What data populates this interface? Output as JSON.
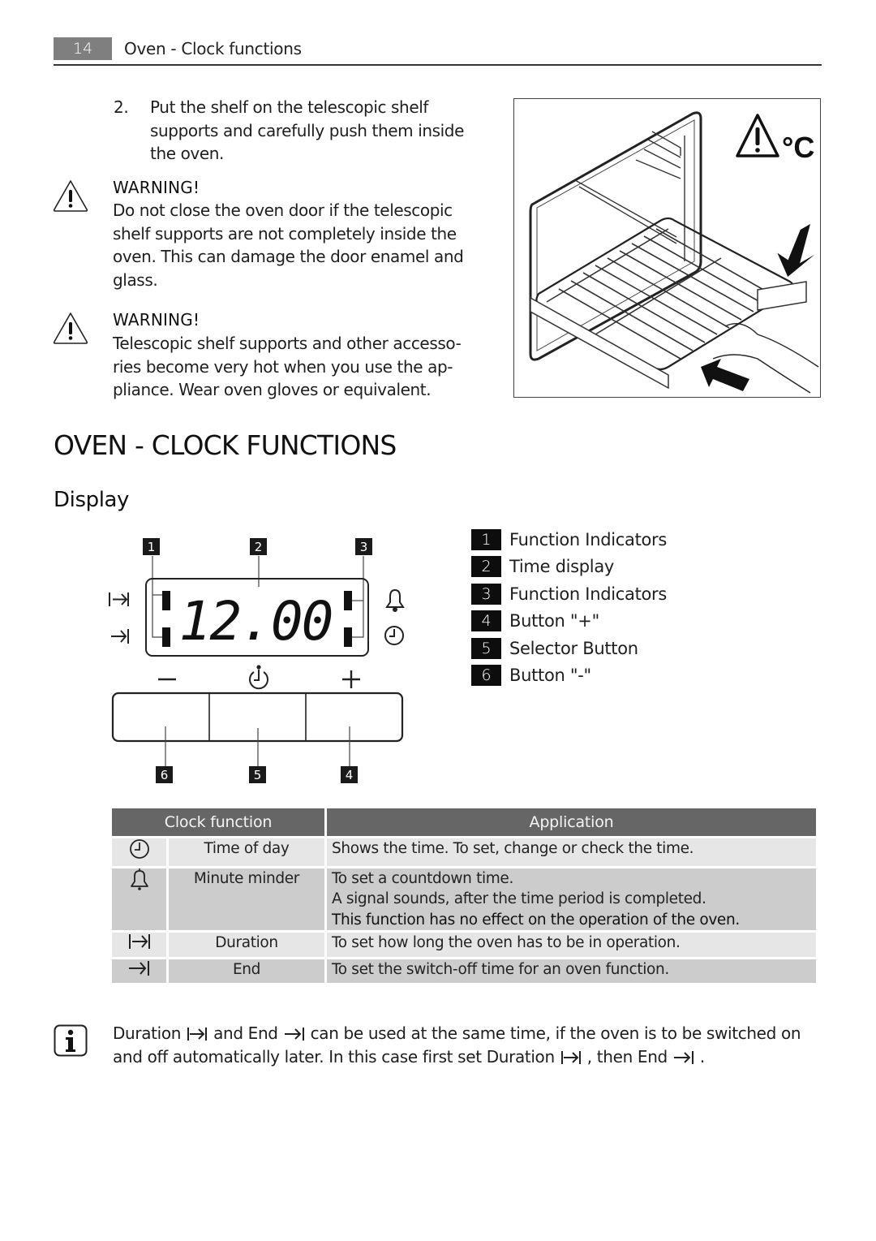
{
  "header": {
    "page_number": "14",
    "section_title": "Oven - Clock functions"
  },
  "instruction_step": {
    "number": "2.",
    "text": "Put the shelf on the telescopic shelf supports and carefully push them inside the oven."
  },
  "warnings": [
    {
      "icon": "warning-triangle-icon",
      "title": "WARNING!",
      "text": "Do not close the oven door if the telescopic shelf supports are not completely inside the oven. This can damage the door enamel and glass."
    },
    {
      "icon": "warning-triangle-icon",
      "title": "WARNING!",
      "text": "Telescopic shelf supports and other accesso-ries become very hot when you use the ap-pliance. Wear oven gloves or equivalent."
    }
  ],
  "illustration": {
    "description": "Hand pushing oven shelf onto telescopic shelf supports",
    "hot_warning_label": "°C"
  },
  "section": {
    "title": "OVEN - CLOCK FUNCTIONS",
    "subtitle": "Display"
  },
  "display_diagram": {
    "time_value": "12.00",
    "top_callouts": [
      "1",
      "2",
      "3"
    ],
    "bottom_callouts": [
      "6",
      "5",
      "4"
    ],
    "left_indicators": [
      "duration-icon",
      "end-icon"
    ],
    "right_indicators": [
      "bell-icon",
      "clock-icon"
    ],
    "buttons": [
      {
        "symbol": "minus-icon",
        "callout": "6"
      },
      {
        "symbol": "selector-clock-icon",
        "callout": "5"
      },
      {
        "symbol": "plus-icon",
        "callout": "4"
      }
    ]
  },
  "legend": [
    {
      "number": "1",
      "label": "Function Indicators"
    },
    {
      "number": "2",
      "label": "Time display"
    },
    {
      "number": "3",
      "label": "Function Indicators"
    },
    {
      "number": "4",
      "label": "Button \"+\""
    },
    {
      "number": "5",
      "label": "Selector Button"
    },
    {
      "number": "6",
      "label": "Button \"-\""
    }
  ],
  "table": {
    "headers": [
      "Clock function",
      "Application"
    ],
    "rows": [
      {
        "icon": "clock-icon",
        "name": "Time of day",
        "application": [
          "Shows the time. To set, change or check the time."
        ],
        "application_bold": ""
      },
      {
        "icon": "bell-icon",
        "name": "Minute minder",
        "application": [
          "To set a countdown time.",
          "A signal sounds, after the time period is completed."
        ],
        "application_bold": "This function has no effect on the operation of the oven."
      },
      {
        "icon": "duration-icon",
        "name": "Duration",
        "application": [
          "To set how long the oven has to be in operation."
        ],
        "application_bold": ""
      },
      {
        "icon": "end-icon",
        "name": "End",
        "application": [
          "To set the switch-off time for an oven function."
        ],
        "application_bold": ""
      }
    ]
  },
  "info_note": {
    "icon": "info-icon",
    "parts": [
      "Duration",
      " and End ",
      " can be used at the same time, if the oven is to be switched on and off automatically later. In this case first set Duration ",
      " , then End ",
      " ."
    ]
  }
}
